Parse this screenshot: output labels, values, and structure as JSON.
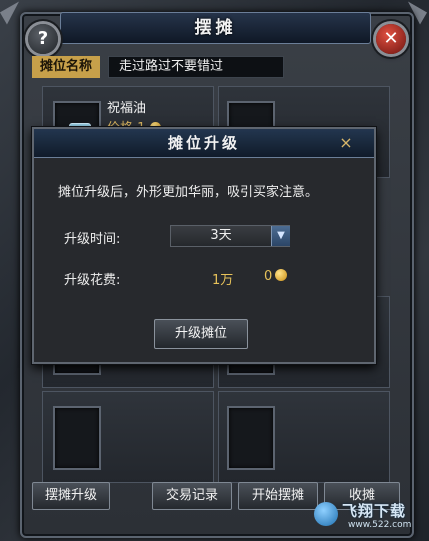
{
  "window": {
    "title": "摆摊",
    "help_icon": "question-mark-icon",
    "close_icon": "close-x-icon"
  },
  "stall_name": {
    "label": "摊位名称",
    "value": "走过路过不要错过"
  },
  "item": {
    "name": "祝福油",
    "price_label": "价格 1"
  },
  "upgrade_dialog": {
    "title": "摊位升级",
    "close_symbol": "×",
    "description": "摊位升级后，外形更加华丽，吸引买家注意。",
    "time_label": "升级时间:",
    "time_value": "3天",
    "cost_label": "升级花费:",
    "cost_silver": "1万",
    "cost_gold": "0",
    "confirm_label": "升级摊位"
  },
  "buttons": {
    "upgrade": "摆摊升级",
    "trade_log": "交易记录",
    "start": "开始摆摊",
    "close_stall": "收摊"
  },
  "watermark": {
    "text": "飞翔下载",
    "url": "www.522.com"
  },
  "colors": {
    "gold": "#e7c25a",
    "title_blue": "#1a2a40",
    "close_red": "#c23a2c"
  }
}
